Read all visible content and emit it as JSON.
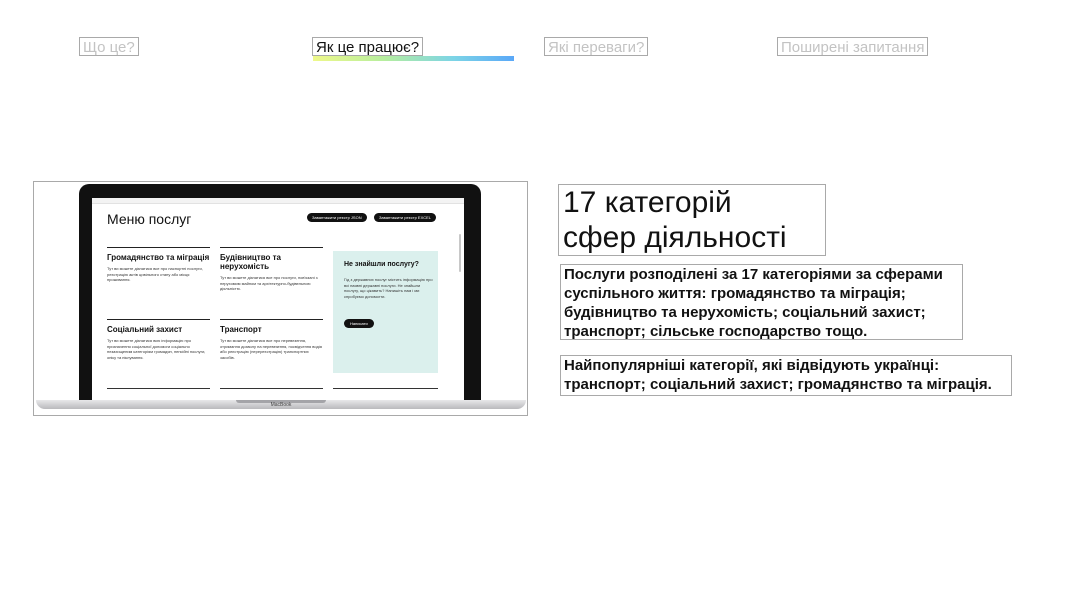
{
  "tabs": [
    {
      "label": "Що це?",
      "active": false
    },
    {
      "label": "Як це працює?",
      "active": true
    },
    {
      "label": "Які переваги?",
      "active": false
    },
    {
      "label": "Поширені запитання",
      "active": false
    }
  ],
  "colors": {
    "text": "#111111",
    "tab_inactive": "#c3c3c3",
    "outline": "#a9a9a9",
    "underline_gradient": [
      "#eef88a",
      "#7cd4e6",
      "#5aa8f8"
    ],
    "help_box_bg": "#dbf0ed"
  },
  "screenshot": {
    "title": "Меню послуг",
    "buttons": [
      "Завантажити реєстр JSON",
      "Завантажити реєстр EXCEL"
    ],
    "categories": [
      {
        "title": "Громадянство та міграція",
        "description": "Тут ви можете дізнатися все про паспортні послуги, реєстрацію актів цивільного стану або місця проживання."
      },
      {
        "title": "Будівництво та нерухомість",
        "description": "Тут ви можете дізнатися все про послуги, пов'язані з нерухомим майном та архітектурно-будівельною діяльністю."
      },
      {
        "title": "Соціальний захист",
        "description": "Тут ви можете дізнатися всю інформацію про призначення соціальної допомоги соціально незахищеним категоріям громадян, пенсійні послуги, опіку та піклування."
      },
      {
        "title": "Транспорт",
        "description": "Тут ви можете дізнатися все про перевезення, отримання дозволу на перевезення, посвідчення водія або реєстрацію (перереєстрацію) транспортних засобів."
      }
    ],
    "help": {
      "title": "Не знайшли послугу?",
      "description": "Гід з державних послуг містить інформацію про всі наявні державні послуги. Не знайшли послугу, що цікавить? Напишіть нам і ми спробуємо допомогти.",
      "button": "Написати"
    },
    "device_label": "MacBook"
  },
  "content": {
    "heading_line1": "17 категорій",
    "heading_line2": "сфер діяльності",
    "paragraph1": "Послуги розподілені за 17 категоріями за сферами суспільного життя: громадянство та міграція; будівництво та нерухомість; соціальний захист; транспорт; сільське господарство тощо.",
    "paragraph2": "Найпопулярніші категорії, які відвідують українці: транспорт; соціальний захист; громадянство та міграція."
  }
}
